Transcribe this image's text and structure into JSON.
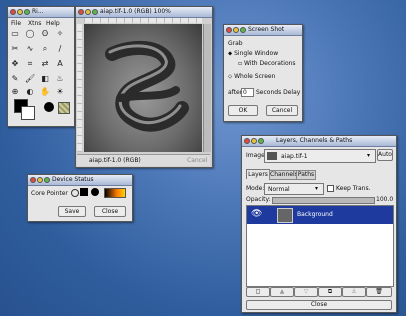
{
  "toolbox": {
    "title": "Ri...",
    "menu": [
      "File",
      "Xtns",
      "Help"
    ],
    "tool_icons": [
      "rect-select",
      "ellipse-select",
      "lasso",
      "magic-wand",
      "scissors",
      "bezier",
      "zoom",
      "measure",
      "move",
      "crop",
      "flip",
      "transform",
      "text",
      "color-picker",
      "bucket-fill",
      "blend",
      "pencil",
      "paintbrush",
      "eraser",
      "airbrush",
      "clone",
      "convolve",
      "dodge-burn",
      "smudge"
    ]
  },
  "image_window": {
    "title": "aiap.tif-1.0 (RGB) 100%",
    "status": "aiap.tif-1.0 (RGB)",
    "cancel_label": "Cancel"
  },
  "screenshot_dialog": {
    "title": "Screen Shot",
    "grab_label": "Grab",
    "single_window": "Single Window",
    "with_decorations": "With Decorations",
    "whole_screen": "Whole Screen",
    "after_label": "after",
    "delay_value": "0",
    "delay_label": "Seconds Delay",
    "ok_label": "OK",
    "cancel_label": "Cancel"
  },
  "device_status": {
    "title": "Device Status",
    "core_pointer": "Core Pointer",
    "save_label": "Save",
    "close_label": "Close"
  },
  "layers_dialog": {
    "title": "Layers, Channels & Paths",
    "image_label": "Image:",
    "image_value": "aiap.tif-1",
    "auto_label": "Auto",
    "tabs": [
      "Layers",
      "Channels",
      "Paths"
    ],
    "mode_label": "Mode:",
    "mode_value": "Normal",
    "keep_trans_label": "Keep Trans.",
    "opacity_label": "Opacity:",
    "opacity_value": "100.0",
    "layer_name": "Background",
    "close_label": "Close"
  },
  "colors": {
    "desktop": "#3e6aa8",
    "selection": "#1e3a9e",
    "window": "#e6e6e6"
  }
}
